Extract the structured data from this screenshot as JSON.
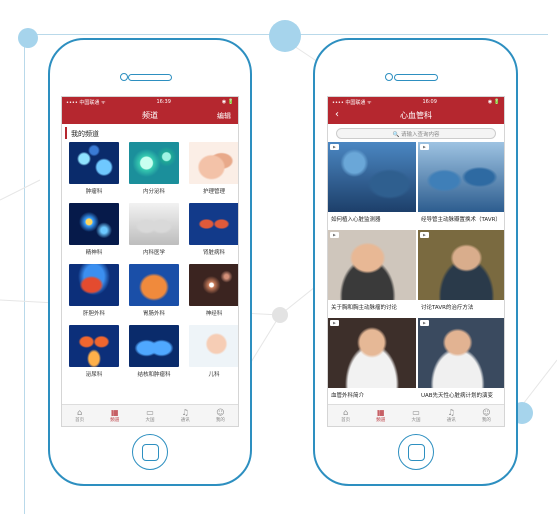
{
  "left_phone": {
    "status": {
      "carrier": "•••• 中国联通 ᯤ",
      "time": "16:39",
      "battery": "◉ 🔋"
    },
    "nav_title": "频道",
    "nav_edit": "编辑",
    "section_title": "我的频道",
    "channels": [
      {
        "label": "肿瘤科",
        "icon": "cancer-cells"
      },
      {
        "label": "内分泌科",
        "icon": "cells-blue-green"
      },
      {
        "label": "护理管理",
        "icon": "hands-care"
      },
      {
        "label": "精神科",
        "icon": "neurons"
      },
      {
        "label": "内科医学",
        "icon": "chest-xray"
      },
      {
        "label": "肾脏病科",
        "icon": "kidney"
      },
      {
        "label": "肝胆外科",
        "icon": "liver"
      },
      {
        "label": "胃肠外科",
        "icon": "stomach"
      },
      {
        "label": "神经科",
        "icon": "neurons-dark"
      },
      {
        "label": "泌尿科",
        "icon": "urinary"
      },
      {
        "label": "结核和肿瘤科",
        "icon": "lungs"
      },
      {
        "label": "儿科",
        "icon": "baby"
      }
    ],
    "tabs": [
      {
        "label": "首页",
        "icon": "home-icon",
        "active": false
      },
      {
        "label": "频道",
        "icon": "grid-icon",
        "active": true
      },
      {
        "label": "大国",
        "icon": "chat-icon",
        "active": false
      },
      {
        "label": "通讯",
        "icon": "bell-icon",
        "active": false
      },
      {
        "label": "我的",
        "icon": "person-icon",
        "active": false
      }
    ]
  },
  "right_phone": {
    "status": {
      "carrier": "•••• 中国联通 ᯤ",
      "time": "16:09",
      "battery": "◉ 🔋"
    },
    "nav_title": "心血管科",
    "back": "‹",
    "search_placeholder": "🔍 请输入查询内容",
    "videos": [
      {
        "title": "如何植入心脏监测器"
      },
      {
        "title": "经导管主动脉瓣置换术（TAVR）"
      },
      {
        "title": "关于胸和胸主动脉瘤的讨论"
      },
      {
        "title": "讨论TAVR的治疗方法"
      },
      {
        "title": "血管外科简介"
      },
      {
        "title": "UAB先天性心脏病计划的演变"
      }
    ],
    "tabs": [
      {
        "label": "首页",
        "icon": "home-icon",
        "active": false
      },
      {
        "label": "频道",
        "icon": "grid-icon",
        "active": true
      },
      {
        "label": "大国",
        "icon": "chat-icon",
        "active": false
      },
      {
        "label": "通讯",
        "icon": "bell-icon",
        "active": false
      },
      {
        "label": "我的",
        "icon": "person-icon",
        "active": false
      }
    ]
  },
  "colors": {
    "brand_red": "#b5272f",
    "phone_outline": "#2d8fc0",
    "accent_blue": "#a6d4ec"
  }
}
